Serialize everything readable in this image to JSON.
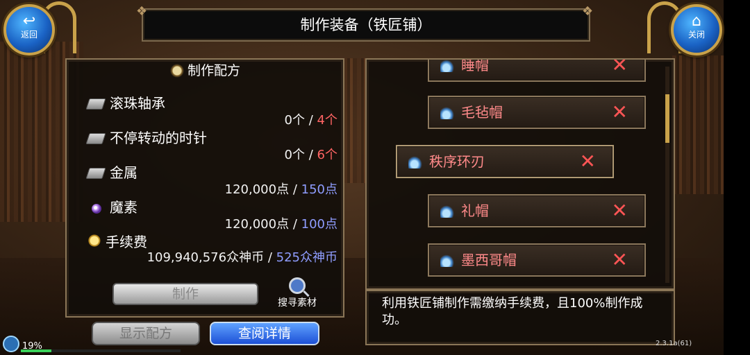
{
  "header": {
    "title": "制作装备（铁匠铺）",
    "back_label": "返回",
    "close_label": "关闭"
  },
  "recipe": {
    "title": "制作配方",
    "materials": [
      {
        "name": "滚珠轴承",
        "icon": "ingot-icon",
        "have": "0个",
        "need": "4个",
        "need_color": "red"
      },
      {
        "name": "不停转动的时针",
        "icon": "ingot-icon",
        "have": "0个",
        "need": "6个",
        "need_color": "red"
      },
      {
        "name": "金属",
        "icon": "ingot-icon",
        "have": "120,000点",
        "need": "150点",
        "need_color": "blue"
      },
      {
        "name": "魔素",
        "icon": "orb-icon",
        "have": "120,000点",
        "need": "100点",
        "need_color": "blue"
      },
      {
        "name": "手续费",
        "icon": "coin-icon",
        "have": "109,940,576众神币",
        "need": "525众神币",
        "need_color": "blue"
      }
    ],
    "separator": "/",
    "make_label": "制作",
    "search_label": "搜寻素材"
  },
  "buttons": {
    "show_recipe": "显示配方",
    "view_detail": "查阅详情"
  },
  "items": [
    {
      "name": "睡帽"
    },
    {
      "name": "毛毡帽"
    },
    {
      "name": "秩序环刃"
    },
    {
      "name": "礼帽"
    },
    {
      "name": "墨西哥帽"
    }
  ],
  "remove_glyph": "✕",
  "description": "利用铁匠铺制作需缴纳手续费，且100%制作成功。",
  "status": {
    "percent": "19%",
    "progress": 0.19,
    "version": "2.3.1a(61)"
  },
  "colors": {
    "need_red": "#ff6464",
    "need_blue": "#8f9dff",
    "item_name": "#ff8a8a",
    "remove_x": "#ff5555",
    "accent_blue": "#1d50d6"
  }
}
